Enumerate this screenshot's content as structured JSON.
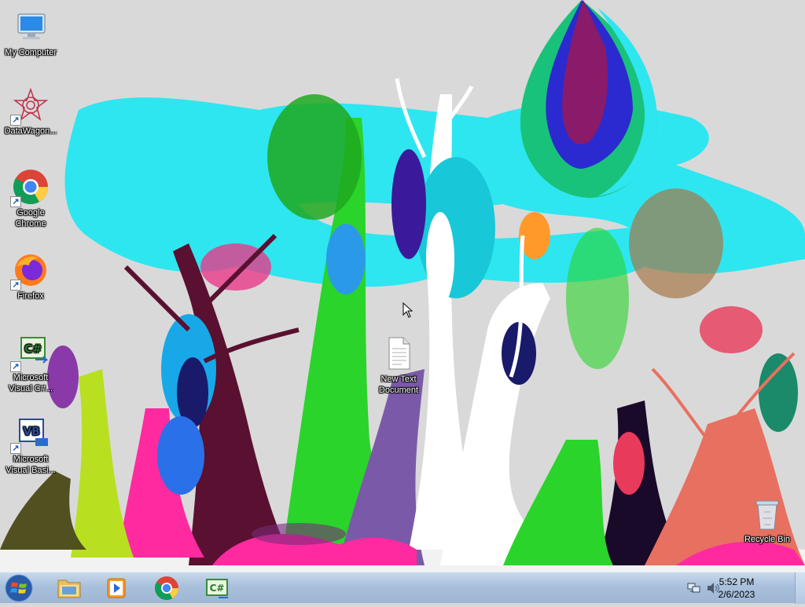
{
  "desktop": {
    "icons": [
      {
        "label": "My Computer",
        "icon": "computer-icon"
      },
      {
        "label": "DataWagon...",
        "icon": "datawagon-icon"
      },
      {
        "label": "Google Chrome",
        "icon": "chrome-icon"
      },
      {
        "label": "Firefox",
        "icon": "firefox-icon"
      },
      {
        "label": "Microsoft Visual C#...",
        "icon": "visual-csharp-icon"
      },
      {
        "label": "Microsoft Visual Basi...",
        "icon": "visual-basic-icon"
      },
      {
        "label": "New Text Document",
        "icon": "text-document-icon"
      },
      {
        "label": "Recycle Bin",
        "icon": "recycle-bin-icon"
      }
    ]
  },
  "taskbar": {
    "start": {
      "icon": "windows-logo-icon"
    },
    "pinned": [
      {
        "name": "Windows Explorer",
        "icon": "folder-icon"
      },
      {
        "name": "Windows Media Player",
        "icon": "media-player-icon"
      },
      {
        "name": "Google Chrome",
        "icon": "chrome-icon"
      },
      {
        "name": "Microsoft Visual C#",
        "icon": "visual-csharp-icon"
      }
    ],
    "tray": {
      "network_icon": "network-icon",
      "volume_icon": "speaker-icon",
      "time": "5:52 PM",
      "date": "2/6/2023"
    }
  },
  "colors": {
    "taskbar": "#a9c0dc",
    "cloud": "#2ee6f0",
    "sky": "#d9d9d9"
  }
}
